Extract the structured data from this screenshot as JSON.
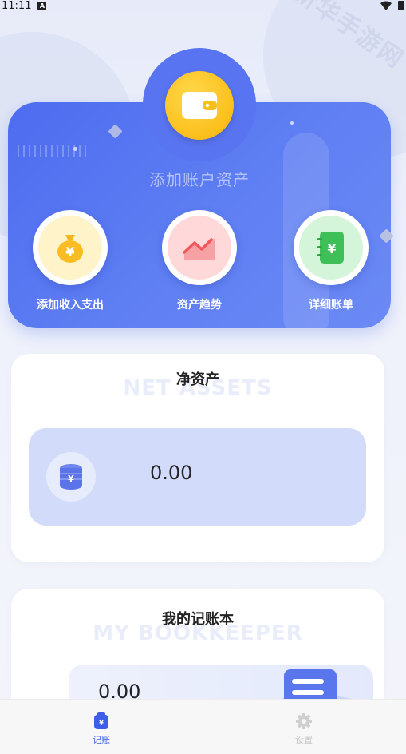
{
  "status_bar": {
    "time": "11:11",
    "notification_badge": "A"
  },
  "watermark": "新华手游网",
  "hero": {
    "title": "添加账户资产",
    "actions": [
      {
        "label": "添加收入支出",
        "icon": "money-bag-icon",
        "color": "#fcc22a"
      },
      {
        "label": "资产趋势",
        "icon": "trend-chart-icon",
        "color": "#f46f72"
      },
      {
        "label": "详细账单",
        "icon": "bill-book-icon",
        "color": "#3fbf57"
      }
    ]
  },
  "net_assets": {
    "title": "净资产",
    "bg_title": "NET ASSETS",
    "value": "0.00"
  },
  "bookkeeper": {
    "title": "我的记账本",
    "bg_title": "MY BOOKKEEPER",
    "value": "0.00"
  },
  "bottom_nav": [
    {
      "label": "记账",
      "icon": "bookkeeping-icon",
      "active": true
    },
    {
      "label": "设置",
      "icon": "settings-gear-icon",
      "active": false
    }
  ],
  "colors": {
    "primary": "#4d6cf0",
    "active_nav": "#3f5ee8",
    "asset_box": "#d3dbfa"
  }
}
